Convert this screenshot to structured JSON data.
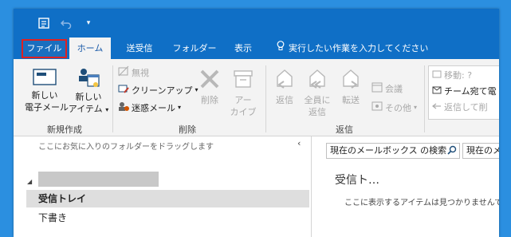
{
  "quick_access": {
    "undo_icon": "undo-icon",
    "customize_icon": "dropdown-arrow-icon",
    "sendreceive_icon": "send-receive-icon"
  },
  "tabs": [
    {
      "label": "ファイル"
    },
    {
      "label": "ホーム"
    },
    {
      "label": "送受信"
    },
    {
      "label": "フォルダー"
    },
    {
      "label": "表示"
    }
  ],
  "tell_me": {
    "label": "実行したい作業を入力してください",
    "icon": "lightbulb-icon"
  },
  "ribbon": {
    "new_group": {
      "label": "新規作成",
      "new_email": "新しい 電子メール",
      "new_email_l1": "新しい",
      "new_email_l2": "電子メール",
      "new_items_l1": "新しい",
      "new_items_l2": "アイテム"
    },
    "delete_group": {
      "label": "削除",
      "ignore": "無視",
      "cleanup": "クリーンアップ",
      "junk": "迷惑メール",
      "delete": "削除",
      "archive_l1": "アー",
      "archive_l2": "カイブ"
    },
    "respond_group": {
      "label": "返信",
      "reply": "返信",
      "reply_all_l1": "全員に",
      "reply_all_l2": "返信",
      "forward": "転送",
      "meeting": "会議",
      "more": "その他"
    },
    "quick_steps": {
      "move_to": "移動: ?",
      "team_email": "チーム宛て電",
      "reply_delete": "返信して削"
    }
  },
  "folder_pane": {
    "hint": "ここにお気に入りのフォルダーをドラッグします",
    "collapse": "‹",
    "folders": [
      "受信トレイ",
      "下書き"
    ]
  },
  "mail_pane": {
    "search_placeholder": "現在のメールボックス の検索",
    "scope": "現在のメ",
    "title": "受信ト…",
    "empty_message": "ここに表示するアイテムは見つかりませんで"
  },
  "colors": {
    "accent": "#0f6fc6",
    "file_tab_highlight": "#e02020",
    "background": "#2b8fe0"
  }
}
